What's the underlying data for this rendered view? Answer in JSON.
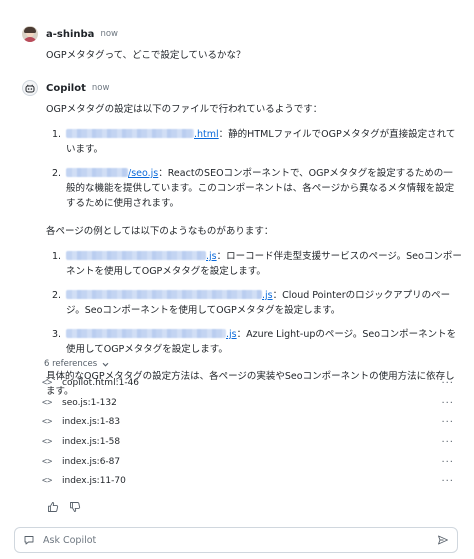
{
  "user_message": {
    "author": "a-shinba",
    "time": "now",
    "text": "OGPメタタグって、どこで設定しているかな？"
  },
  "copilot_message": {
    "author": "Copilot",
    "time": "now",
    "intro": "OGPメタタグの設定は以下のファイルで行われているようです：",
    "files": [
      {
        "num": "1.",
        "link": ".html",
        "text": "：静的HTMLファイルでOGPメタタグが直接設定されています。"
      },
      {
        "num": "2.",
        "link": "/seo.js",
        "text": "：ReactのSEOコンポーネントで、OGPメタタグを設定するための一般的な機能を提供しています。このコンポーネントは、各ページから異なるメタ情報を設定するために使用されます。"
      }
    ],
    "examples_intro": "各ページの例としては以下のようなものがあります：",
    "examples": [
      {
        "num": "1.",
        "link": ".js",
        "text": "：ローコード伴走型支援サービスのページ。Seoコンポーネントを使用してOGPメタタグを設定します。"
      },
      {
        "num": "2.",
        "link": ".js",
        "text": "：Cloud Pointerのロジックアプリのページ。Seoコンポーネントを使用してOGPメタタグを設定します。"
      },
      {
        "num": "3.",
        "link": ".js",
        "text": "：Azure Light-upのページ。Seoコンポーネントを使用してOGPメタタグを設定します。"
      }
    ],
    "conclusion": "具体的なOGPメタタグの設定方法は、各ページの実装やSeoコンポーネントの使用方法に依存します。"
  },
  "references": {
    "toggle_label": "6 references",
    "items": [
      {
        "icon": "code-icon",
        "label": "copilot.html:1-46"
      },
      {
        "icon": "code-icon",
        "label": "seo.js:1-132"
      },
      {
        "icon": "code-icon",
        "label": "index.js:1-83"
      },
      {
        "icon": "code-icon",
        "label": "index.js:1-58"
      },
      {
        "icon": "code-icon",
        "label": "index.js:6-87"
      },
      {
        "icon": "code-icon",
        "label": "index.js:11-70"
      }
    ]
  },
  "input": {
    "placeholder": "Ask Copilot"
  },
  "colors": {
    "link": "#0969da",
    "muted": "#57606a",
    "border": "#d0d7de"
  }
}
